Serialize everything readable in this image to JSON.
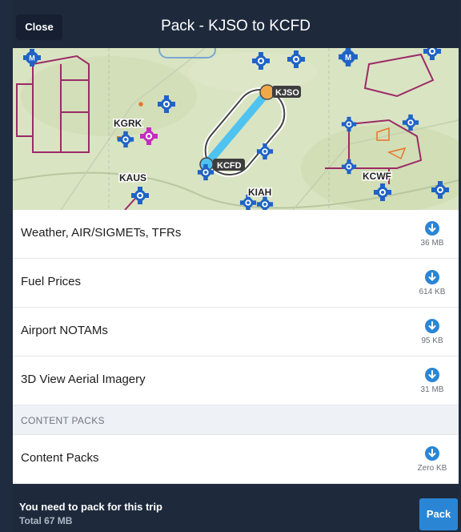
{
  "header": {
    "close_label": "Close",
    "title": "Pack - KJSO to KCFD"
  },
  "map": {
    "airports": {
      "kjso": "KJSO",
      "kcfd": "KCFD",
      "kgrk": "KGRK",
      "kaus": "KAUS",
      "kiah": "KIAH",
      "kcwf": "KCWF"
    },
    "route_color": "#4fc3f0",
    "origin_marker_color": "#f0a94a",
    "icons": [
      "airport-marker-icon",
      "military-airport-icon"
    ]
  },
  "rows": [
    {
      "label": "Weather, AIR/SIGMETs, TFRs",
      "size": "36 MB"
    },
    {
      "label": "Fuel Prices",
      "size": "614 KB"
    },
    {
      "label": "Airport NOTAMs",
      "size": "95 KB"
    },
    {
      "label": "3D View Aerial Imagery",
      "size": "31 MB"
    }
  ],
  "section": {
    "title": "CONTENT PACKS"
  },
  "content_row": {
    "label": "Content Packs",
    "size": "Zero KB"
  },
  "footer": {
    "message": "You need to pack for this trip",
    "total": "Total 67 MB",
    "pack_label": "Pack"
  },
  "colors": {
    "header_bg": "#1e2a3c",
    "accent": "#2a86d5",
    "download_icon": "#2a86d5"
  }
}
